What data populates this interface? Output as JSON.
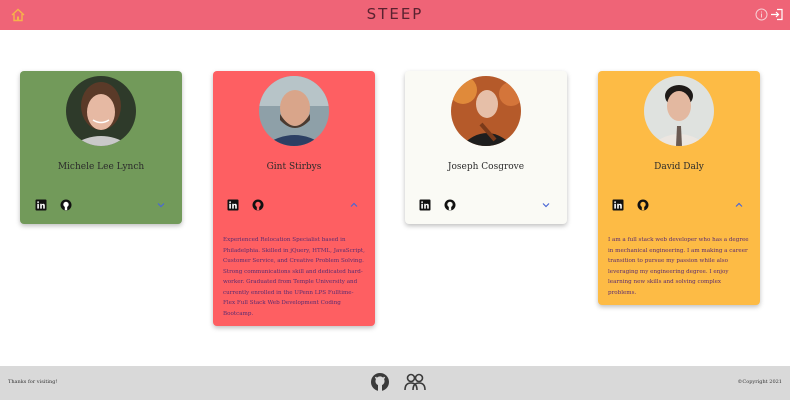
{
  "header": {
    "brand": "STEEP",
    "home_icon": "home-icon",
    "info_icon": "info-icon",
    "login_icon": "login-icon",
    "bg_color": "#ef6477",
    "home_icon_color": "#f6b34a"
  },
  "cards": [
    {
      "name": "Michele Lee Lynch",
      "bg_color": "#729a5a",
      "expanded": false,
      "bio": "",
      "icons": [
        "linkedin-icon",
        "github-icon",
        "chevron-down-icon"
      ]
    },
    {
      "name": "Gint Stirbys",
      "bg_color": "#fe5f62",
      "expanded": true,
      "bio": "Experienced Relocation Specialist based in Philadelphia. Skilled in jQuery, HTML, JavaScript, Customer Service, and Creative Problem Solving. Strong communications skill and dedicated hard-worker. Graduated from Temple University and currently enrolled in the UPenn LPS Fulltime-Flex Full Stack Web Development Coding Bootcamp.",
      "icons": [
        "linkedin-icon",
        "github-icon",
        "chevron-up-icon"
      ]
    },
    {
      "name": "Joseph Cosgrove",
      "bg_color": "#fafaf5",
      "expanded": false,
      "bio": "",
      "icons": [
        "linkedin-icon",
        "github-icon",
        "chevron-down-icon"
      ]
    },
    {
      "name": "David Daly",
      "bg_color": "#fdbb45",
      "expanded": true,
      "bio": "I am a full stack web developer who has a degree in mechanical engineering. I am making a career transition to pursue my passion while also leveraging my engineering degree. I enjoy learning new skills and solving complex problems.",
      "icons": [
        "linkedin-icon",
        "github-icon",
        "chevron-up-icon"
      ]
    }
  ],
  "footer": {
    "thanks": "Thanks for visiting!",
    "copyright": "©Copyright 2021",
    "icons": [
      "github-icon",
      "team-icon"
    ],
    "bg_color": "#d9d9d9"
  }
}
